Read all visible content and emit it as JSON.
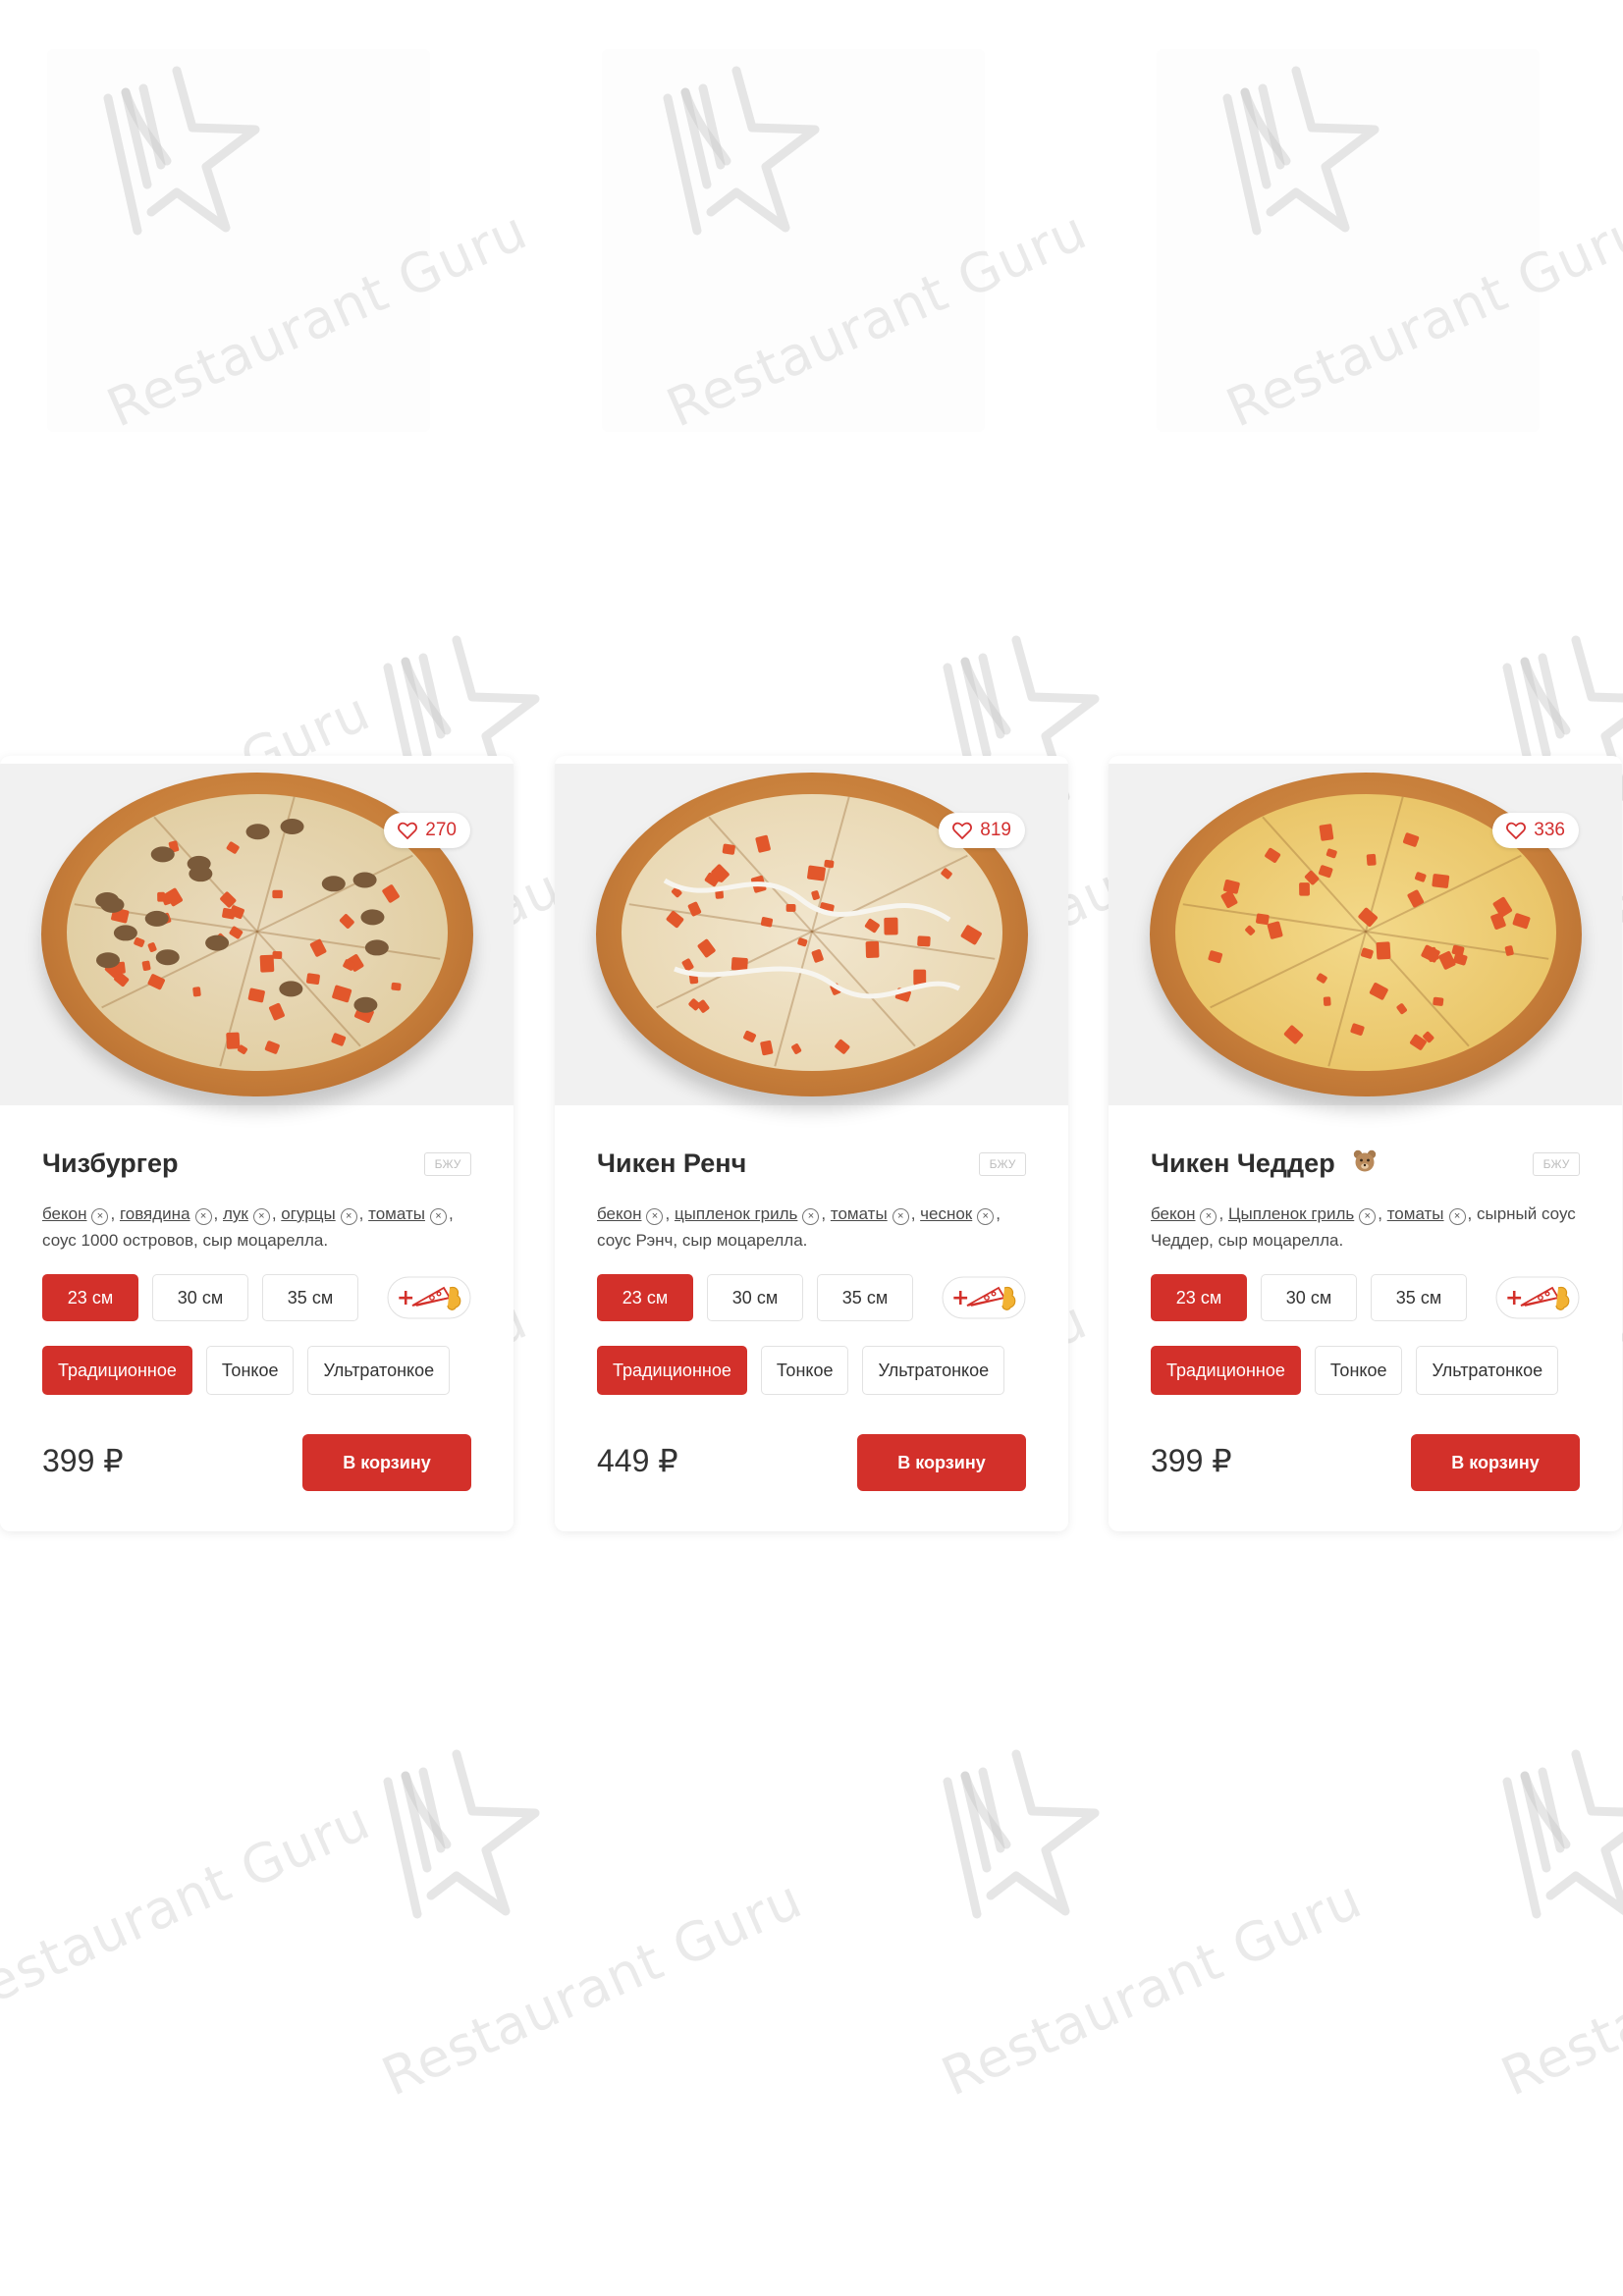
{
  "watermark": {
    "text": "Restaurant Guru"
  },
  "products": [
    {
      "name": "Чизбургер",
      "likes": "270",
      "nutrition_label": "БЖУ",
      "has_bear_icon": false,
      "ingredients": [
        {
          "text": "бекон",
          "removable": true
        },
        {
          "text": "говядина",
          "removable": true
        },
        {
          "text": "лук",
          "removable": true
        },
        {
          "text": "огурцы",
          "removable": true
        },
        {
          "text": "томаты",
          "removable": true
        },
        {
          "text": "соус 1000 островов, сыр моцарелла.",
          "removable": false
        }
      ],
      "sizes": [
        "23 см",
        "30 см",
        "35 см"
      ],
      "selected_size": "23 см",
      "doughs": [
        "Традиционное",
        "Тонкое",
        "Ультратонкое"
      ],
      "selected_dough": "Традиционное",
      "price": "399 ₽",
      "cart_label": "В корзину"
    },
    {
      "name": "Чикен Ренч",
      "likes": "819",
      "nutrition_label": "БЖУ",
      "has_bear_icon": false,
      "ingredients": [
        {
          "text": "бекон",
          "removable": true
        },
        {
          "text": "цыпленок гриль",
          "removable": true
        },
        {
          "text": "томаты",
          "removable": true
        },
        {
          "text": "чеснок",
          "removable": true
        },
        {
          "text": "соус Рэнч, сыр моцарелла.",
          "removable": false
        }
      ],
      "sizes": [
        "23 см",
        "30 см",
        "35 см"
      ],
      "selected_size": "23 см",
      "doughs": [
        "Традиционное",
        "Тонкое",
        "Ультратонкое"
      ],
      "selected_dough": "Традиционное",
      "price": "449 ₽",
      "cart_label": "В корзину"
    },
    {
      "name": "Чикен Чеддер",
      "likes": "336",
      "nutrition_label": "БЖУ",
      "has_bear_icon": true,
      "ingredients": [
        {
          "text": "бекон",
          "removable": true
        },
        {
          "text": "Цыпленок гриль",
          "removable": true
        },
        {
          "text": "томаты",
          "removable": true
        },
        {
          "text": "сырный соус Чеддер, сыр моцарелла.",
          "removable": false
        }
      ],
      "sizes": [
        "23 см",
        "30 см",
        "35 см"
      ],
      "selected_size": "23 см",
      "doughs": [
        "Традиционное",
        "Тонкое",
        "Ультратонкое"
      ],
      "selected_dough": "Традиционное",
      "price": "399 ₽",
      "cart_label": "В корзину"
    }
  ],
  "colors": {
    "accent": "#d3302a",
    "like": "#d32f2f",
    "crust": "#c77e3a",
    "cheese": "#f2dfb6",
    "tomato": "#e2572b"
  }
}
